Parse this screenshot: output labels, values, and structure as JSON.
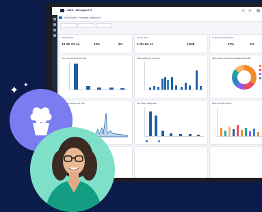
{
  "app": {
    "title": "AWS · Wireguard X",
    "breadcrumb": "Dashboards / manager-dashboard"
  },
  "kpis": [
    {
      "title": "Workstations",
      "values": [
        {
          "value": "14 Oh 7m 1s"
        },
        {
          "value": "13%"
        },
        {
          "value": "2%"
        }
      ]
    },
    {
      "title": "Device data",
      "values": [
        {
          "value": "1 Oh 1m 1s"
        },
        {
          "value": "1,036"
        }
      ]
    },
    {
      "title": "Connected applications",
      "values": [
        {
          "value": "67%"
        },
        {
          "value": "1%"
        }
      ]
    }
  ],
  "charts": [
    {
      "title": "Top 5 connections per host"
    },
    {
      "title": "Other activity by app type"
    },
    {
      "title": "Most active users across global data traffic"
    },
    {
      "title": "Average events over time"
    },
    {
      "title": "Top 5 alert categories"
    },
    {
      "title": "Most common events"
    }
  ],
  "colors": {
    "background": "#0b1b4a",
    "primary_bar": "#1f5fa8",
    "accent_bar": "#2e86c1",
    "accent_teal": "#1fa2a8",
    "purple_circle": "#7a7cf0",
    "teal_circle": "#7ee0c9"
  },
  "icons": [
    "sparkle-icon",
    "plant-icon",
    "avatar-photo"
  ]
}
